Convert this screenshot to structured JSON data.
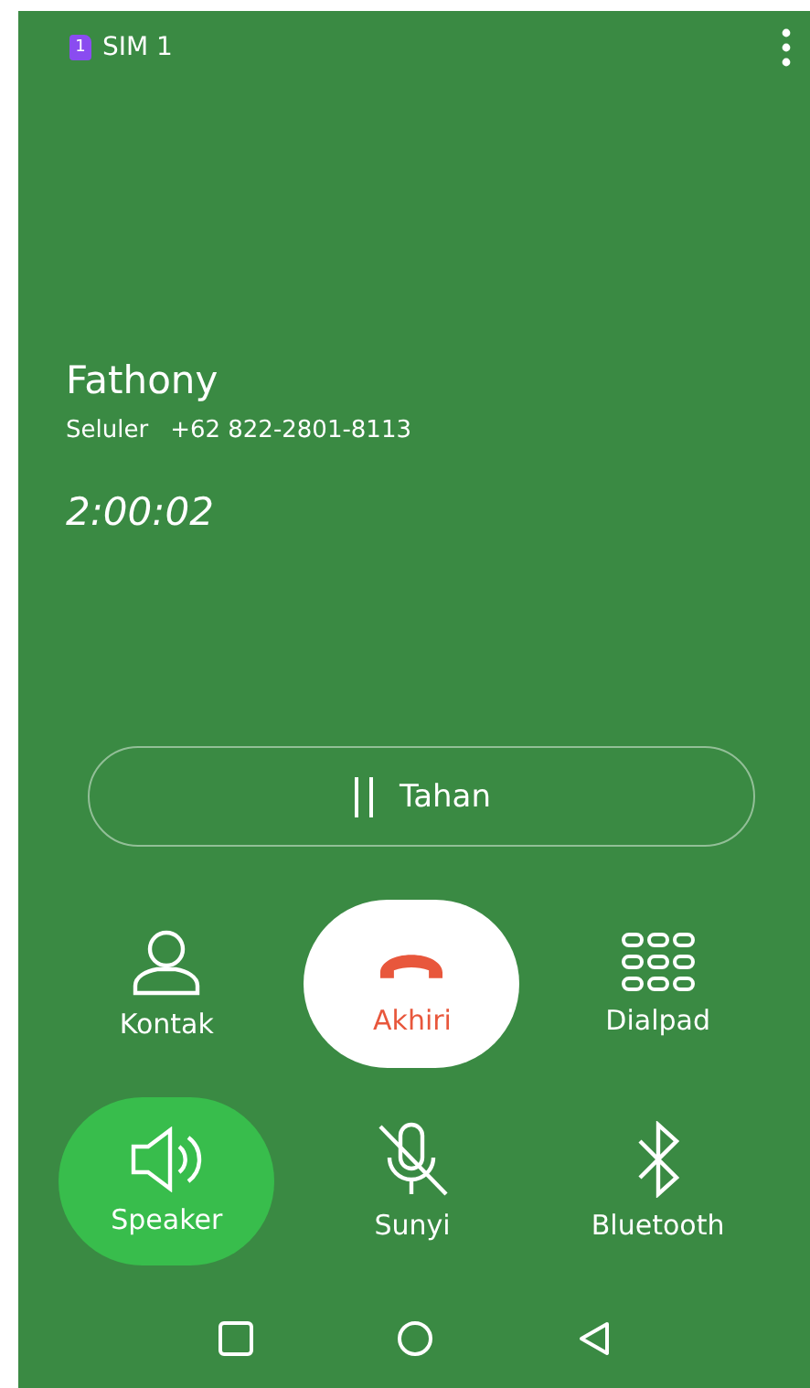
{
  "status_bar": {
    "sim_badge": "1",
    "sim_label": "SIM 1"
  },
  "caller": {
    "name": "Fathony",
    "number_type": "Seluler",
    "number": "+62 822-2801-8113",
    "duration": "2:00:02"
  },
  "hold_button": {
    "label": "Tahan"
  },
  "controls": [
    {
      "kind": "contact",
      "label": "Kontak"
    },
    {
      "kind": "end",
      "label": "Akhiri"
    },
    {
      "kind": "dialpad",
      "label": "Dialpad"
    },
    {
      "kind": "speaker",
      "label": "Speaker",
      "on": true
    },
    {
      "kind": "mute",
      "label": "Sunyi",
      "on": false
    },
    {
      "kind": "bluetooth",
      "label": "Bluetooth",
      "on": false
    }
  ]
}
